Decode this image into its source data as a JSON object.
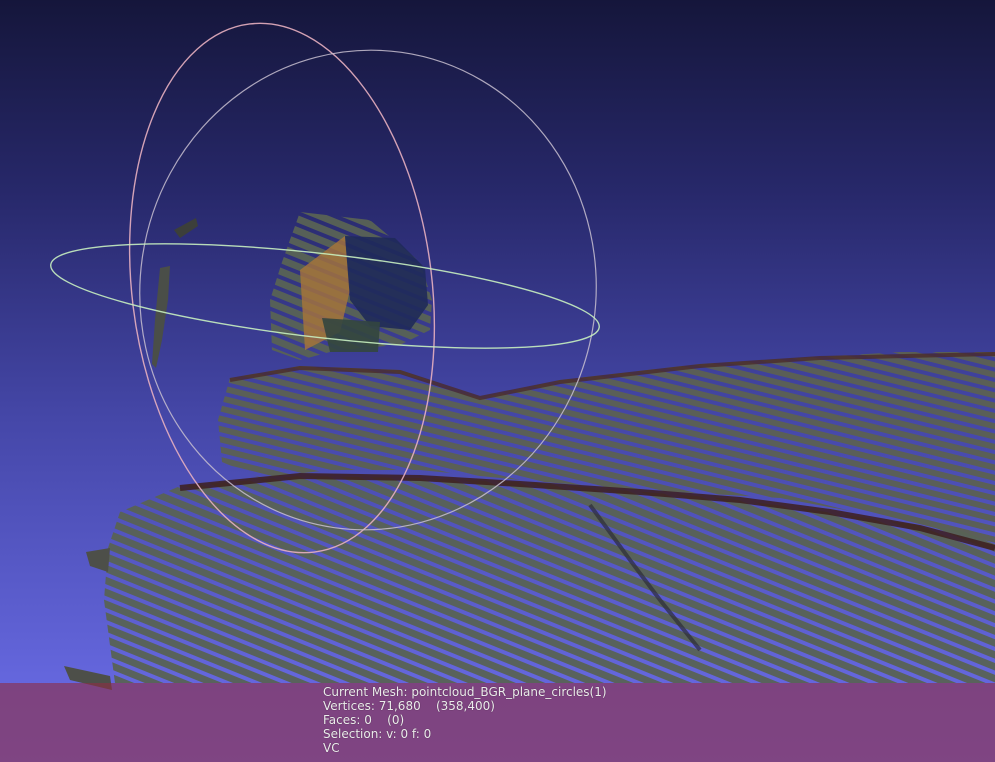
{
  "info": {
    "current_mesh": "Current Mesh: pointcloud_BGR_plane_circles(1)",
    "vertices": "Vertices: 71,680    (358,400)",
    "faces": "Faces: 0    (0)",
    "selection": "Selection: v: 0 f: 0",
    "color_mode": "VC"
  },
  "colors": {
    "background_top": "#15163b",
    "background_bottom": "#6a6ce6",
    "info_panel": "#8c2d46",
    "trackball_ring_pink": "#e8b0c0",
    "trackball_ring_grey": "#c8c0d0",
    "trackball_ring_green": "#c8f0c0"
  }
}
